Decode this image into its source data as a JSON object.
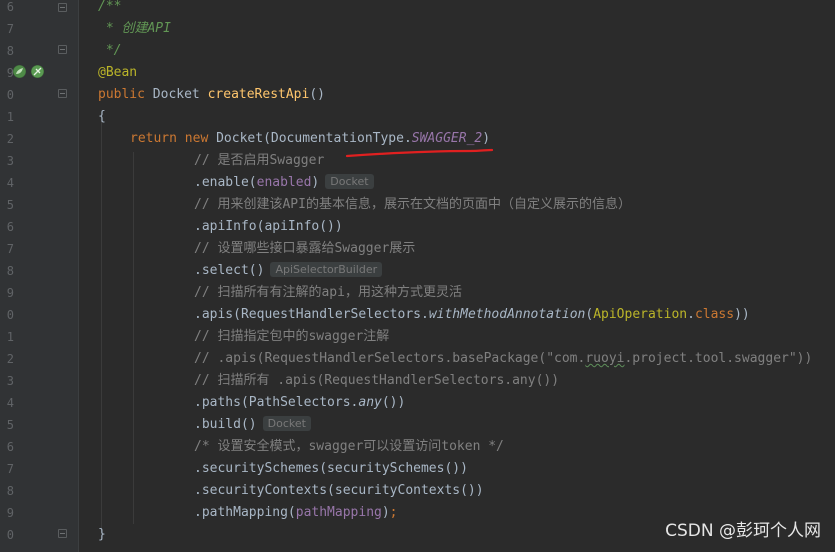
{
  "gutter": {
    "line_numbers": [
      "6",
      "7",
      "8",
      "9",
      "0",
      "1",
      "2",
      "3",
      "4",
      "5",
      "6",
      "7",
      "8",
      "9",
      "0",
      "1",
      "2",
      "3",
      "4",
      "5",
      "6",
      "7",
      "8",
      "9",
      "0"
    ]
  },
  "code_lines": [
    {
      "tokens": [
        {
          "t": "/**",
          "c": "doc"
        }
      ]
    },
    {
      "tokens": [
        {
          "t": " * ",
          "c": "doc"
        },
        {
          "t": "创建API",
          "c": "doc"
        }
      ]
    },
    {
      "tokens": [
        {
          "t": " */",
          "c": "doc"
        }
      ]
    },
    {
      "tokens": [
        {
          "t": "@Bean",
          "c": "ann"
        }
      ]
    },
    {
      "tokens": [
        {
          "t": "public ",
          "c": "kw"
        },
        {
          "t": "Docket ",
          "c": ""
        },
        {
          "t": "createRestApi",
          "c": "fn"
        },
        {
          "t": "()",
          "c": ""
        }
      ]
    },
    {
      "tokens": [
        {
          "t": "{",
          "c": ""
        }
      ]
    },
    {
      "tokens": [
        {
          "t": "return ",
          "c": "kw"
        },
        {
          "t": "new ",
          "c": "kw"
        },
        {
          "t": "Docket(DocumentationType.",
          "c": ""
        },
        {
          "t": "SWAGGER_2",
          "c": "stat"
        },
        {
          "t": ")",
          "c": ""
        }
      ]
    },
    {
      "tokens": [
        {
          "t": "// 是否启用Swagger",
          "c": "cm"
        }
      ]
    },
    {
      "tokens": [
        {
          "t": ".enable(",
          "c": ""
        },
        {
          "t": "enabled",
          "c": "fld"
        },
        {
          "t": ")",
          "c": ""
        }
      ],
      "hint": "Docket"
    },
    {
      "tokens": [
        {
          "t": "// 用来创建该API的基本信息，展示在文档的页面中（自定义展示的信息）",
          "c": "cm"
        }
      ]
    },
    {
      "tokens": [
        {
          "t": ".apiInfo(apiInfo())",
          "c": ""
        }
      ]
    },
    {
      "tokens": [
        {
          "t": "// 设置哪些接口暴露给Swagger展示",
          "c": "cm"
        }
      ]
    },
    {
      "tokens": [
        {
          "t": ".select()",
          "c": ""
        }
      ],
      "hint": "ApiSelectorBuilder"
    },
    {
      "tokens": [
        {
          "t": "// 扫描所有有注解的api，用这种方式更灵活",
          "c": "cm"
        }
      ]
    },
    {
      "tokens": [
        {
          "t": ".apis(RequestHandlerSelectors.",
          "c": ""
        },
        {
          "t": "withMethodAnnotation",
          "c": "it"
        },
        {
          "t": "(",
          "c": ""
        },
        {
          "t": "ApiOperation",
          "c": "ann"
        },
        {
          "t": ".",
          "c": ""
        },
        {
          "t": "class",
          "c": "kw"
        },
        {
          "t": "))",
          "c": ""
        }
      ]
    },
    {
      "tokens": [
        {
          "t": "// 扫描指定包中的swagger注解",
          "c": "cm"
        }
      ]
    },
    {
      "tokens": [
        {
          "t": "// .apis(RequestHandlerSelectors.basePackage(\"com.",
          "c": "cm"
        },
        {
          "t": "ruoyi",
          "c": "cm squig"
        },
        {
          "t": ".project.tool.swagger\"))",
          "c": "cm"
        }
      ]
    },
    {
      "tokens": [
        {
          "t": "// 扫描所有 .apis(RequestHandlerSelectors.any())",
          "c": "cm"
        }
      ]
    },
    {
      "tokens": [
        {
          "t": ".paths(PathSelectors.",
          "c": ""
        },
        {
          "t": "any",
          "c": "it"
        },
        {
          "t": "())",
          "c": ""
        }
      ]
    },
    {
      "tokens": [
        {
          "t": ".build()",
          "c": ""
        }
      ],
      "hint": "Docket"
    },
    {
      "tokens": [
        {
          "t": "/* 设置安全模式，swagger可以设置访问token */",
          "c": "cm"
        }
      ]
    },
    {
      "tokens": [
        {
          "t": ".securitySchemes(securitySchemes())",
          "c": ""
        }
      ]
    },
    {
      "tokens": [
        {
          "t": ".securityContexts(securityContexts())",
          "c": ""
        }
      ]
    },
    {
      "tokens": [
        {
          "t": ".pathMapping(",
          "c": ""
        },
        {
          "t": "pathMapping",
          "c": "fld"
        },
        {
          "t": ")",
          "c": ""
        },
        {
          "t": ";",
          "c": "kw"
        }
      ]
    },
    {
      "tokens": [
        {
          "t": "}",
          "c": ""
        }
      ]
    }
  ],
  "watermark": "CSDN @彭珂个人网",
  "colors": {
    "background": "#2b2b2b",
    "keyword": "#cc7832",
    "method": "#ffc66d",
    "annotation": "#bbb529",
    "comment": "#808080",
    "javadoc": "#629755",
    "static_field": "#9876aa",
    "underline_annotation": "#e02020"
  },
  "icons": [
    "spring-bean-icon",
    "leaf-icon"
  ]
}
